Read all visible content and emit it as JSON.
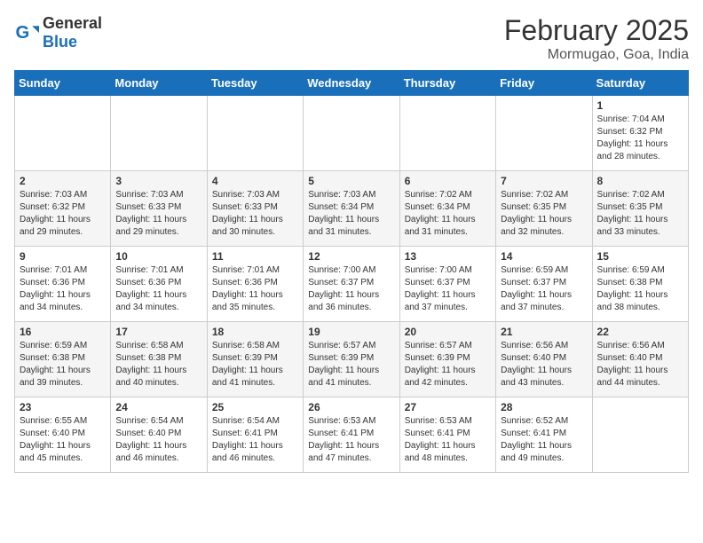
{
  "header": {
    "logo_general": "General",
    "logo_blue": "Blue",
    "month_year": "February 2025",
    "location": "Mormugao, Goa, India"
  },
  "weekdays": [
    "Sunday",
    "Monday",
    "Tuesday",
    "Wednesday",
    "Thursday",
    "Friday",
    "Saturday"
  ],
  "weeks": [
    [
      {
        "day": "",
        "info": ""
      },
      {
        "day": "",
        "info": ""
      },
      {
        "day": "",
        "info": ""
      },
      {
        "day": "",
        "info": ""
      },
      {
        "day": "",
        "info": ""
      },
      {
        "day": "",
        "info": ""
      },
      {
        "day": "1",
        "info": "Sunrise: 7:04 AM\nSunset: 6:32 PM\nDaylight: 11 hours and 28 minutes."
      }
    ],
    [
      {
        "day": "2",
        "info": "Sunrise: 7:03 AM\nSunset: 6:32 PM\nDaylight: 11 hours and 29 minutes."
      },
      {
        "day": "3",
        "info": "Sunrise: 7:03 AM\nSunset: 6:33 PM\nDaylight: 11 hours and 29 minutes."
      },
      {
        "day": "4",
        "info": "Sunrise: 7:03 AM\nSunset: 6:33 PM\nDaylight: 11 hours and 30 minutes."
      },
      {
        "day": "5",
        "info": "Sunrise: 7:03 AM\nSunset: 6:34 PM\nDaylight: 11 hours and 31 minutes."
      },
      {
        "day": "6",
        "info": "Sunrise: 7:02 AM\nSunset: 6:34 PM\nDaylight: 11 hours and 31 minutes."
      },
      {
        "day": "7",
        "info": "Sunrise: 7:02 AM\nSunset: 6:35 PM\nDaylight: 11 hours and 32 minutes."
      },
      {
        "day": "8",
        "info": "Sunrise: 7:02 AM\nSunset: 6:35 PM\nDaylight: 11 hours and 33 minutes."
      }
    ],
    [
      {
        "day": "9",
        "info": "Sunrise: 7:01 AM\nSunset: 6:36 PM\nDaylight: 11 hours and 34 minutes."
      },
      {
        "day": "10",
        "info": "Sunrise: 7:01 AM\nSunset: 6:36 PM\nDaylight: 11 hours and 34 minutes."
      },
      {
        "day": "11",
        "info": "Sunrise: 7:01 AM\nSunset: 6:36 PM\nDaylight: 11 hours and 35 minutes."
      },
      {
        "day": "12",
        "info": "Sunrise: 7:00 AM\nSunset: 6:37 PM\nDaylight: 11 hours and 36 minutes."
      },
      {
        "day": "13",
        "info": "Sunrise: 7:00 AM\nSunset: 6:37 PM\nDaylight: 11 hours and 37 minutes."
      },
      {
        "day": "14",
        "info": "Sunrise: 6:59 AM\nSunset: 6:37 PM\nDaylight: 11 hours and 37 minutes."
      },
      {
        "day": "15",
        "info": "Sunrise: 6:59 AM\nSunset: 6:38 PM\nDaylight: 11 hours and 38 minutes."
      }
    ],
    [
      {
        "day": "16",
        "info": "Sunrise: 6:59 AM\nSunset: 6:38 PM\nDaylight: 11 hours and 39 minutes."
      },
      {
        "day": "17",
        "info": "Sunrise: 6:58 AM\nSunset: 6:38 PM\nDaylight: 11 hours and 40 minutes."
      },
      {
        "day": "18",
        "info": "Sunrise: 6:58 AM\nSunset: 6:39 PM\nDaylight: 11 hours and 41 minutes."
      },
      {
        "day": "19",
        "info": "Sunrise: 6:57 AM\nSunset: 6:39 PM\nDaylight: 11 hours and 41 minutes."
      },
      {
        "day": "20",
        "info": "Sunrise: 6:57 AM\nSunset: 6:39 PM\nDaylight: 11 hours and 42 minutes."
      },
      {
        "day": "21",
        "info": "Sunrise: 6:56 AM\nSunset: 6:40 PM\nDaylight: 11 hours and 43 minutes."
      },
      {
        "day": "22",
        "info": "Sunrise: 6:56 AM\nSunset: 6:40 PM\nDaylight: 11 hours and 44 minutes."
      }
    ],
    [
      {
        "day": "23",
        "info": "Sunrise: 6:55 AM\nSunset: 6:40 PM\nDaylight: 11 hours and 45 minutes."
      },
      {
        "day": "24",
        "info": "Sunrise: 6:54 AM\nSunset: 6:40 PM\nDaylight: 11 hours and 46 minutes."
      },
      {
        "day": "25",
        "info": "Sunrise: 6:54 AM\nSunset: 6:41 PM\nDaylight: 11 hours and 46 minutes."
      },
      {
        "day": "26",
        "info": "Sunrise: 6:53 AM\nSunset: 6:41 PM\nDaylight: 11 hours and 47 minutes."
      },
      {
        "day": "27",
        "info": "Sunrise: 6:53 AM\nSunset: 6:41 PM\nDaylight: 11 hours and 48 minutes."
      },
      {
        "day": "28",
        "info": "Sunrise: 6:52 AM\nSunset: 6:41 PM\nDaylight: 11 hours and 49 minutes."
      },
      {
        "day": "",
        "info": ""
      }
    ]
  ]
}
